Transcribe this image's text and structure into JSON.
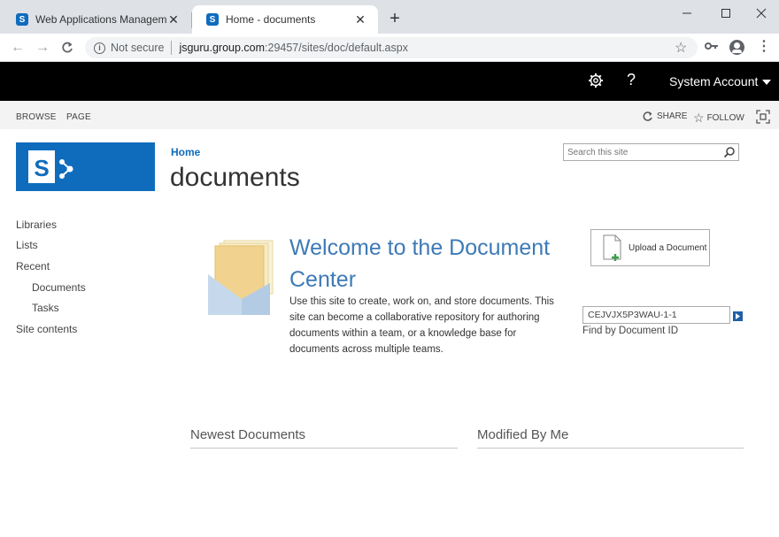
{
  "browser": {
    "tabs": [
      {
        "title": "Web Applications Management",
        "active": false
      },
      {
        "title": "Home - documents",
        "active": true
      }
    ],
    "new_tab_symbol": "+",
    "not_secure": "Not secure",
    "url_host": "jsguru.group.com",
    "url_path": ":29457/sites/doc/default.aspx"
  },
  "suitebar": {
    "account_name": "System Account",
    "help_symbol": "?"
  },
  "ribbon": {
    "tabs": [
      "BROWSE",
      "PAGE"
    ],
    "share_label": "SHARE",
    "follow_label": "FOLLOW"
  },
  "header": {
    "breadcrumb": "Home",
    "title": "documents",
    "search_placeholder": "Search this site"
  },
  "leftnav": {
    "items": [
      {
        "label": "Libraries",
        "level": 0
      },
      {
        "label": "Lists",
        "level": 0
      },
      {
        "label": "Recent",
        "level": 0
      },
      {
        "label": "Documents",
        "level": 1
      },
      {
        "label": "Tasks",
        "level": 1
      },
      {
        "label": "Site contents",
        "level": 0
      }
    ]
  },
  "welcome": {
    "title": "Welcome to the Document Center",
    "description": "Use this site to create, work on, and store documents. This site can become a collaborative repository for authoring documents within a team, or a knowledge base for documents across multiple teams."
  },
  "actions": {
    "upload_label": "Upload a Document",
    "document_id_value": "CEJVJX5P3WAU-1-1",
    "document_id_label": "Find by Document ID"
  },
  "sections": {
    "newest": "Newest Documents",
    "modified": "Modified By Me"
  },
  "colors": {
    "brand_blue": "#0f6cbd",
    "suitebar": "#000000",
    "welcome_title": "#3d7ab7"
  }
}
